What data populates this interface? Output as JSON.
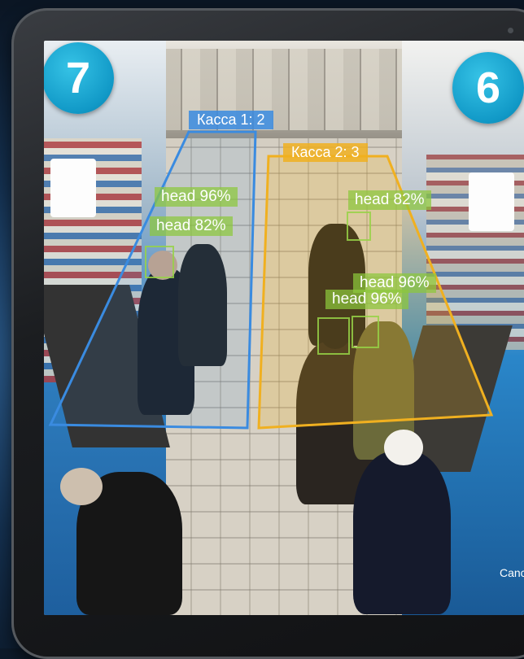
{
  "device": {
    "type": "tablet-frame"
  },
  "camera_view": {
    "zones": [
      {
        "label": "Касса 1: 2",
        "color": "#3a8be0"
      },
      {
        "label": "Касса 2: 3",
        "color": "#f0b020"
      }
    ],
    "detections": [
      {
        "label": "head 96%"
      },
      {
        "label": "head 82%"
      },
      {
        "label": "head 82%"
      },
      {
        "label": "head 96%"
      },
      {
        "label": "head 96%"
      }
    ],
    "badges": [
      {
        "value": "7"
      },
      {
        "value": "6"
      }
    ],
    "corner_text": "Canc"
  },
  "colors": {
    "zone1": "#3a8be0",
    "zone2": "#f0b020",
    "head": "#8cc83c",
    "badge": "#1aa7d6"
  }
}
